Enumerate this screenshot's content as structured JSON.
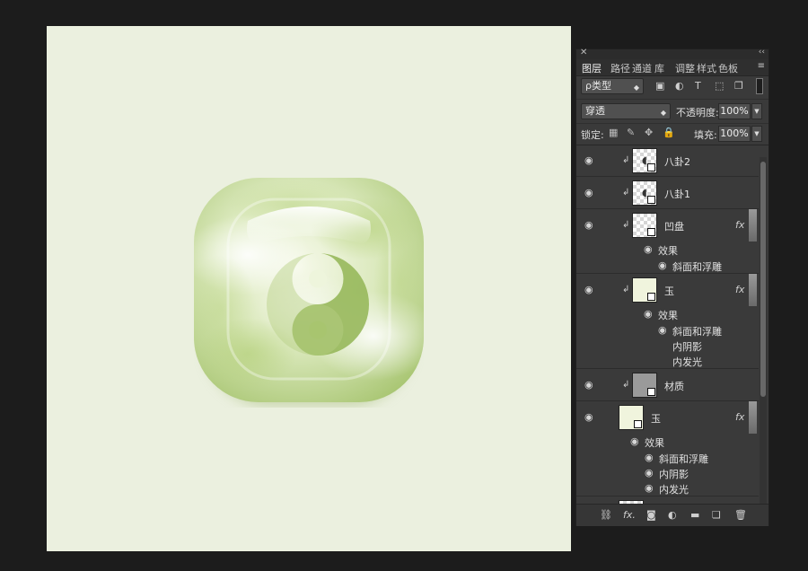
{
  "panel": {
    "close_glyph": "✕",
    "collapse_glyph": "‹‹",
    "tabs": [
      "图层",
      "路径",
      "通道",
      "库",
      "调整",
      "样式",
      "色板"
    ],
    "menu_glyph": "≡"
  },
  "filter": {
    "kind_label": "ρ类型",
    "icons": [
      "image-filter-icon",
      "adjustment-filter-icon",
      "type-filter-icon",
      "shape-filter-icon",
      "smart-object-filter-icon"
    ]
  },
  "blend": {
    "mode": "穿透",
    "opacity_label": "不透明度:",
    "opacity_value": "100%"
  },
  "lock": {
    "label": "锁定:",
    "fill_label": "填充:",
    "fill_value": "100%"
  },
  "layers": [
    {
      "name": "八卦2",
      "clipped": true,
      "fx": false
    },
    {
      "name": "八卦1",
      "clipped": true,
      "fx": false
    },
    {
      "name": "凹盘",
      "clipped": true,
      "fx": true,
      "effects_label": "效果",
      "effects": [
        "斜面和浮雕"
      ]
    },
    {
      "name": "玉",
      "clipped": true,
      "fx": true,
      "effects_label": "效果",
      "effects": [
        "斜面和浮雕",
        "内阴影",
        "内发光"
      ]
    },
    {
      "name": "材质",
      "clipped": true,
      "fx": false
    },
    {
      "name": "玉",
      "clipped": false,
      "fx": true,
      "effects_label": "效果",
      "effects": [
        "斜面和浮雕",
        "内阴影",
        "内发光"
      ]
    }
  ],
  "glyphs": {
    "eye": "◉",
    "clip": "↲",
    "fx": "fx"
  },
  "colors": {
    "canvas_bg": "#ebf0df",
    "jade_light": "#f4f8e6",
    "jade_mid": "#c9dd9c",
    "jade_dark": "#98b960",
    "panel_bg": "#3a3a3a",
    "app_bg": "#1c1c1c"
  }
}
